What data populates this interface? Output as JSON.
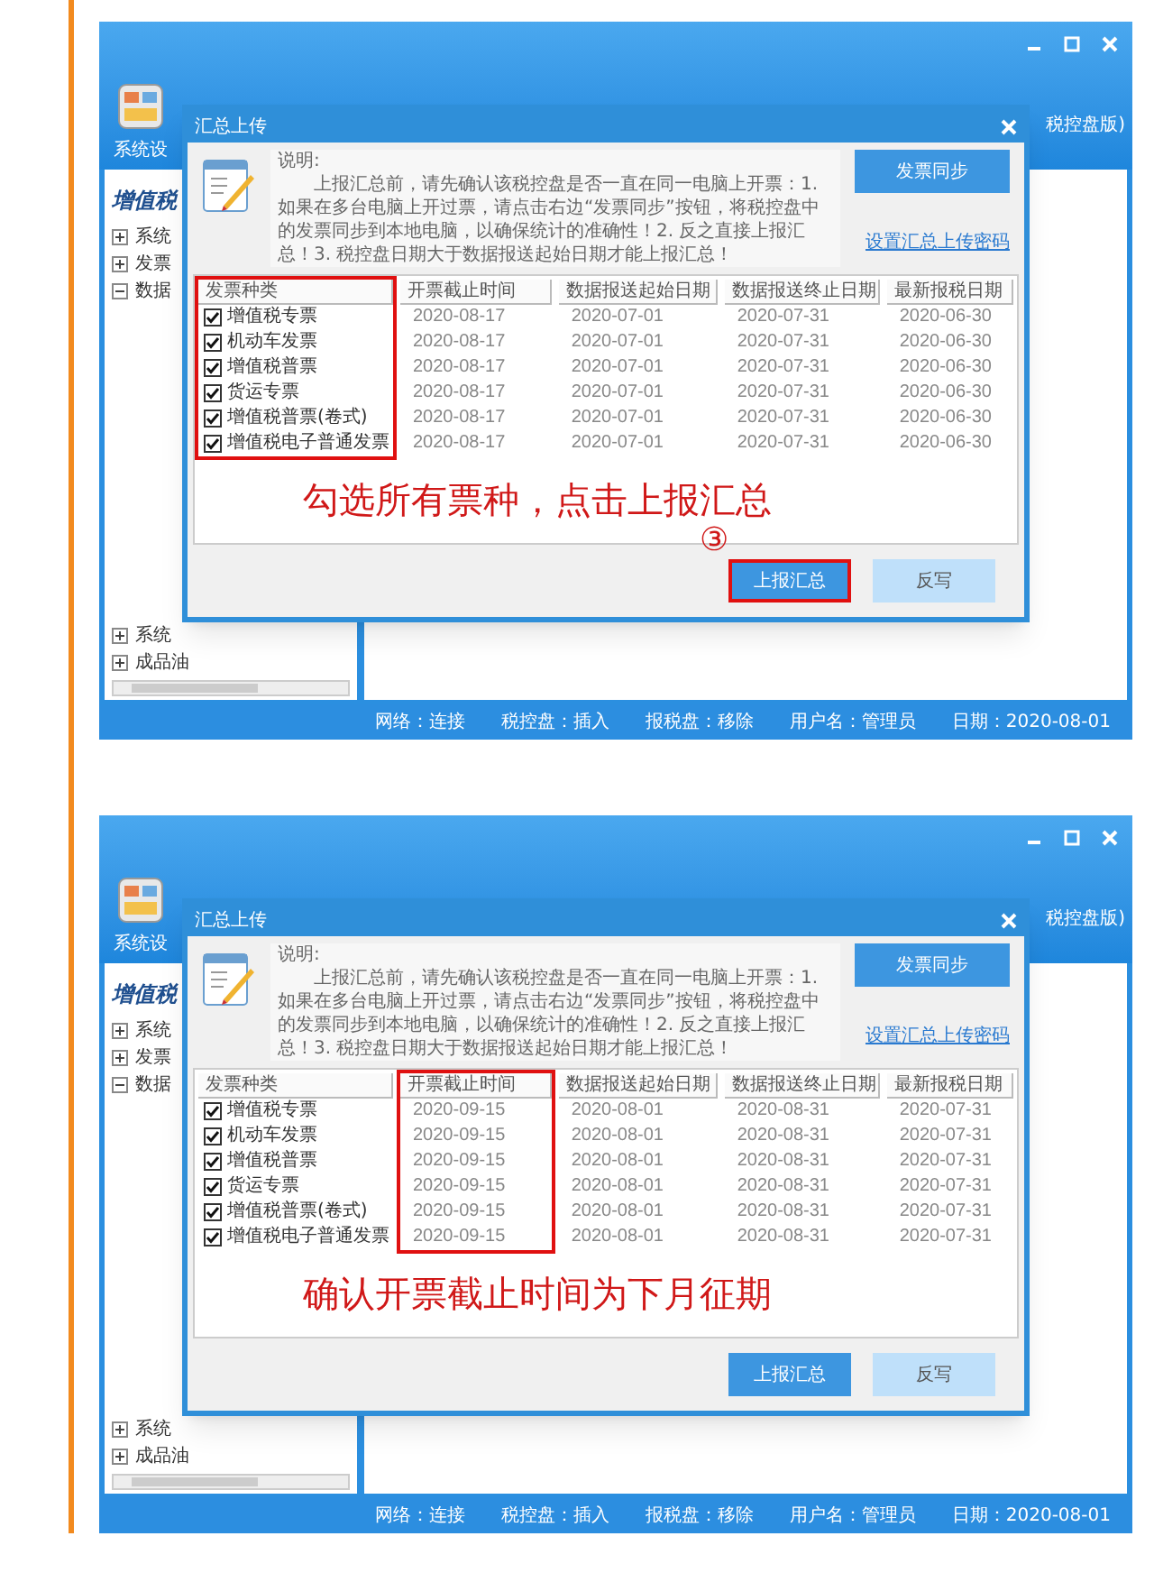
{
  "screenshots": [
    {
      "app_label": "系统设",
      "window_title": "税控盘版)",
      "sidebar_title": "增值税",
      "tree_top": [
        {
          "label": "系统",
          "expanded": false
        },
        {
          "label": "发票",
          "expanded": false
        },
        {
          "label": "数据",
          "expanded": true
        }
      ],
      "tree_bottom": [
        {
          "label": "系统",
          "expanded": false
        },
        {
          "label": "成品油",
          "expanded": false
        }
      ],
      "dialog": {
        "title": "汇总上传",
        "note_label": "说明:",
        "note": "上报汇总前，请先确认该税控盘是否一直在同一电脑上开票：1. 如果在多台电脑上开过票，请点击右边“发票同步”按钮，将税控盘中的发票同步到本地电脑，以确保统计的准确性！2. 反之直接上报汇总！3. 税控盘日期大于数据报送起始日期才能上报汇总！",
        "sync_button": "发票同步",
        "password_link": "设置汇总上传密码",
        "columns": [
          {
            "label": "发票种类",
            "highlighted": true
          },
          {
            "label": "开票截止时间",
            "highlighted": false
          },
          {
            "label": "数据报送起始日期",
            "highlighted": false
          },
          {
            "label": "数据报送终止日期",
            "highlighted": false
          },
          {
            "label": "最新报税日期",
            "highlighted": false
          }
        ],
        "rows": [
          {
            "checked": true,
            "cells": [
              "增值税专票",
              "2020-08-17",
              "2020-07-01",
              "2020-07-31",
              "2020-06-30"
            ]
          },
          {
            "checked": true,
            "cells": [
              "机动车发票",
              "2020-08-17",
              "2020-07-01",
              "2020-07-31",
              "2020-06-30"
            ]
          },
          {
            "checked": true,
            "cells": [
              "增值税普票",
              "2020-08-17",
              "2020-07-01",
              "2020-07-31",
              "2020-06-30"
            ]
          },
          {
            "checked": true,
            "cells": [
              "货运专票",
              "2020-08-17",
              "2020-07-01",
              "2020-07-31",
              "2020-06-30"
            ]
          },
          {
            "checked": true,
            "cells": [
              "增值税普票(卷式)",
              "2020-08-17",
              "2020-07-01",
              "2020-07-31",
              "2020-06-30"
            ]
          },
          {
            "checked": true,
            "cells": [
              "增值税电子普通发票",
              "2020-08-17",
              "2020-07-01",
              "2020-07-31",
              "2020-06-30"
            ]
          }
        ],
        "annotation": "勾选所有票种，点击上报汇总",
        "step": "③",
        "buttons": [
          {
            "label": "上报汇总",
            "highlighted": true
          },
          {
            "label": "反写",
            "highlighted": false
          }
        ]
      },
      "status_bar": [
        "网络：连接",
        "税控盘：插入",
        "报税盘：移除",
        "用户名：管理员",
        "日期：2020-08-01"
      ]
    },
    {
      "app_label": "系统设",
      "window_title": "税控盘版)",
      "sidebar_title": "增值税",
      "tree_top": [
        {
          "label": "系统",
          "expanded": false
        },
        {
          "label": "发票",
          "expanded": false
        },
        {
          "label": "数据",
          "expanded": true
        }
      ],
      "tree_bottom": [
        {
          "label": "系统",
          "expanded": false
        },
        {
          "label": "成品油",
          "expanded": false
        }
      ],
      "dialog": {
        "title": "汇总上传",
        "note_label": "说明:",
        "note": "上报汇总前，请先确认该税控盘是否一直在同一电脑上开票：1. 如果在多台电脑上开过票，请点击右边“发票同步”按钮，将税控盘中的发票同步到本地电脑，以确保统计的准确性！2. 反之直接上报汇总！3. 税控盘日期大于数据报送起始日期才能上报汇总！",
        "sync_button": "发票同步",
        "password_link": "设置汇总上传密码",
        "columns": [
          {
            "label": "发票种类",
            "highlighted": false
          },
          {
            "label": "开票截止时间",
            "highlighted": true
          },
          {
            "label": "数据报送起始日期",
            "highlighted": false
          },
          {
            "label": "数据报送终止日期",
            "highlighted": false
          },
          {
            "label": "最新报税日期",
            "highlighted": false
          }
        ],
        "rows": [
          {
            "checked": true,
            "cells": [
              "增值税专票",
              "2020-09-15",
              "2020-08-01",
              "2020-08-31",
              "2020-07-31"
            ]
          },
          {
            "checked": true,
            "cells": [
              "机动车发票",
              "2020-09-15",
              "2020-08-01",
              "2020-08-31",
              "2020-07-31"
            ]
          },
          {
            "checked": true,
            "cells": [
              "增值税普票",
              "2020-09-15",
              "2020-08-01",
              "2020-08-31",
              "2020-07-31"
            ]
          },
          {
            "checked": true,
            "cells": [
              "货运专票",
              "2020-09-15",
              "2020-08-01",
              "2020-08-31",
              "2020-07-31"
            ]
          },
          {
            "checked": true,
            "cells": [
              "增值税普票(卷式)",
              "2020-09-15",
              "2020-08-01",
              "2020-08-31",
              "2020-07-31"
            ]
          },
          {
            "checked": true,
            "cells": [
              "增值税电子普通发票",
              "2020-09-15",
              "2020-08-01",
              "2020-08-31",
              "2020-07-31"
            ]
          }
        ],
        "annotation": "确认开票截止时间为下月征期",
        "buttons": [
          {
            "label": "上报汇总",
            "highlighted": false
          },
          {
            "label": "反写",
            "highlighted": false
          }
        ]
      },
      "status_bar": [
        "网络：连接",
        "税控盘：插入",
        "报税盘：移除",
        "用户名：管理员",
        "日期：2020-08-01"
      ]
    }
  ]
}
